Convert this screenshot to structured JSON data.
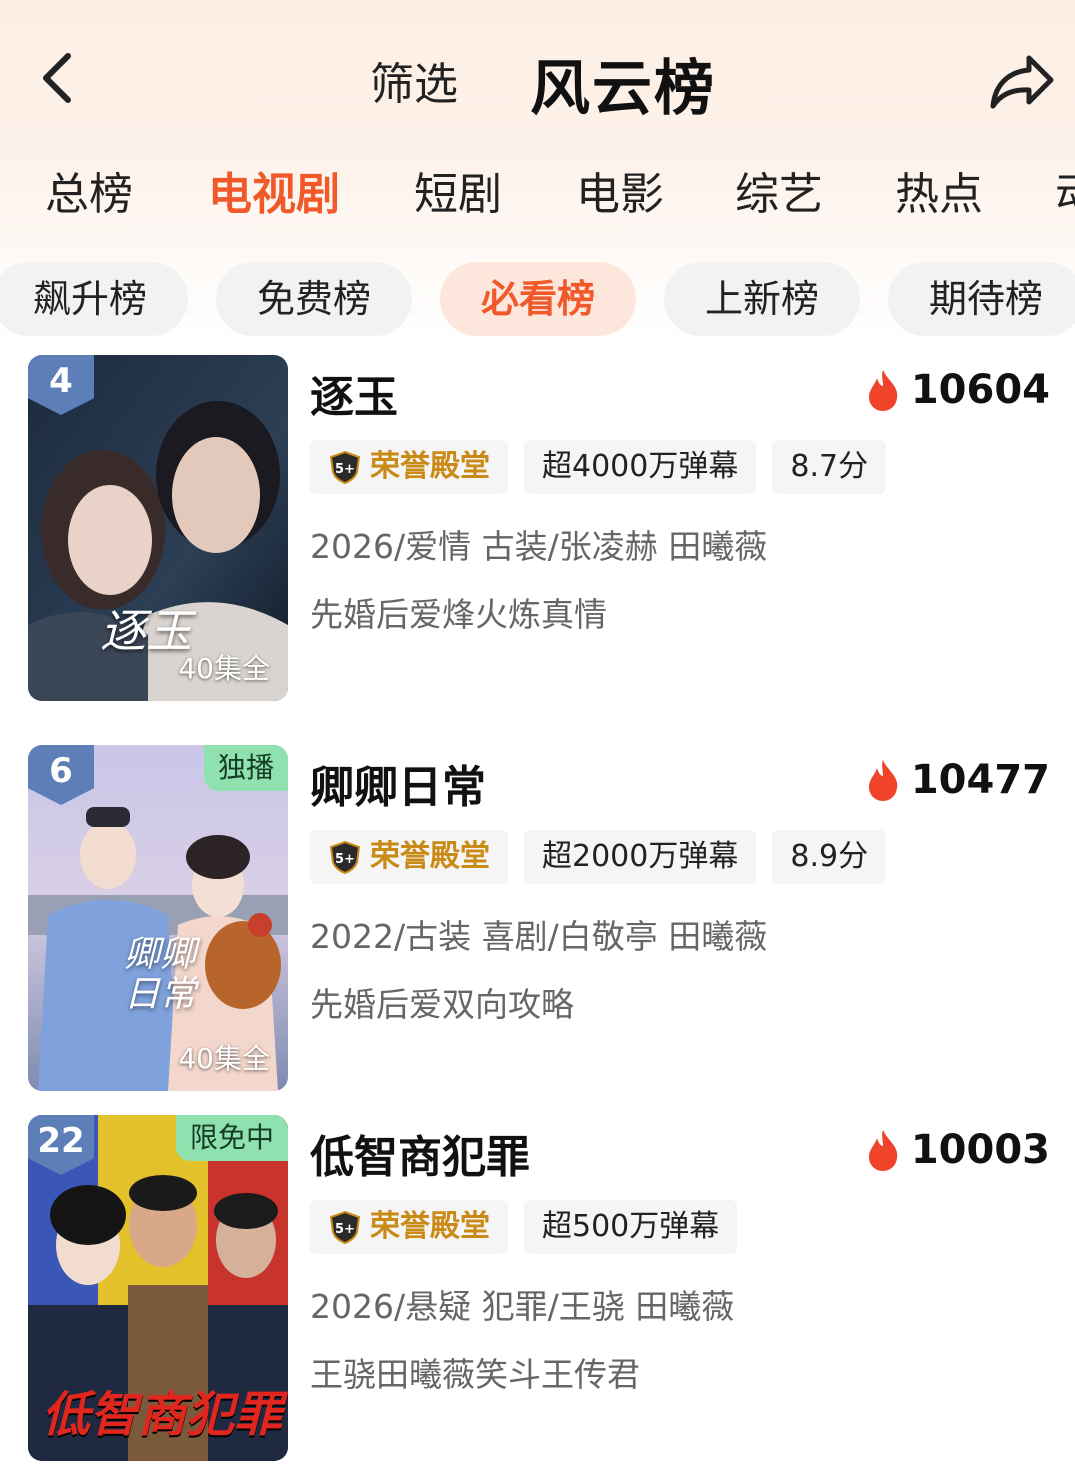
{
  "header": {
    "filter_label": "筛选",
    "title": "风云榜"
  },
  "category_tabs": [
    {
      "label": "总榜",
      "active": false
    },
    {
      "label": "电视剧",
      "active": true
    },
    {
      "label": "短剧",
      "active": false
    },
    {
      "label": "电影",
      "active": false
    },
    {
      "label": "综艺",
      "active": false
    },
    {
      "label": "热点",
      "active": false
    },
    {
      "label": "动",
      "active": false
    }
  ],
  "sub_tabs": [
    {
      "label": "飙升榜",
      "active": false
    },
    {
      "label": "免费榜",
      "active": false
    },
    {
      "label": "必看榜",
      "active": true
    },
    {
      "label": "上新榜",
      "active": false
    },
    {
      "label": "期待榜",
      "active": false
    }
  ],
  "items": [
    {
      "rank": "4",
      "corner_tag": "",
      "episodes": "40集全",
      "poster_text": "逐玉",
      "title": "逐玉",
      "heat": "10604",
      "honor": "荣誉殿堂",
      "danmaku": "超4000万弹幕",
      "score": "8.7分",
      "meta": "2026/爱情 古装/张凌赫 田曦薇",
      "desc": "先婚后爱烽火炼真情"
    },
    {
      "rank": "6",
      "corner_tag": "独播",
      "episodes": "40集全",
      "poster_text": "卿卿日常",
      "title": "卿卿日常",
      "heat": "10477",
      "honor": "荣誉殿堂",
      "danmaku": "超2000万弹幕",
      "score": "8.9分",
      "meta": "2022/古装 喜剧/白敬亭 田曦薇",
      "desc": "先婚后爱双向攻略"
    },
    {
      "rank": "22",
      "corner_tag": "限免中",
      "episodes": "",
      "poster_text": "低智商犯罪",
      "title": "低智商犯罪",
      "heat": "10003",
      "honor": "荣誉殿堂",
      "danmaku": "超500万弹幕",
      "score": "",
      "meta": "2026/悬疑 犯罪/王骁 田曦薇",
      "desc": "王骁田曦薇笑斗王传君"
    }
  ],
  "colors": {
    "accent": "#f05a2a",
    "honor_gold": "#c98a16",
    "rank_badge": "#5d7fb8",
    "corner_tag": "#8fe2b0",
    "heat_fire": "#f0442a"
  }
}
